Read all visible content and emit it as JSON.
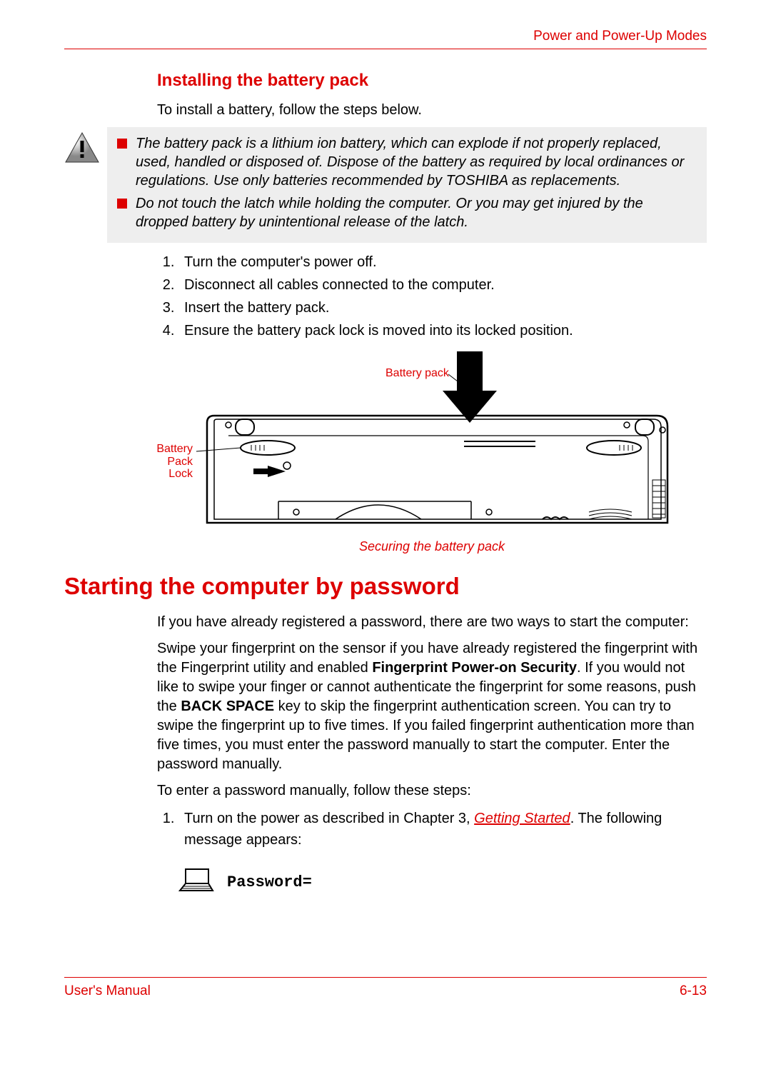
{
  "header": {
    "title": "Power and Power-Up Modes"
  },
  "section1": {
    "heading": "Installing the battery pack",
    "intro": "To install a battery, follow the steps below.",
    "cautions": [
      "The battery pack is a lithium ion battery, which can explode if not properly replaced, used, handled or disposed of. Dispose of the battery as required by local ordinances or regulations. Use only batteries recommended by TOSHIBA as replacements.",
      "Do not touch the latch while holding the computer. Or you may get injured by the dropped battery by unintentional release of the latch."
    ],
    "steps": [
      "Turn the computer's power off.",
      "Disconnect all cables connected to the computer.",
      "Insert the battery pack.",
      "Ensure the battery pack lock is moved into its locked position."
    ],
    "figure": {
      "label_battery_pack": "Battery pack",
      "label_battery_lock": "Battery Pack Lock",
      "caption": "Securing the battery pack"
    }
  },
  "section2": {
    "heading": "Starting the computer by password",
    "p1": "If you have already registered a password, there are two ways to start the computer:",
    "p2_pre": "Swipe your fingerprint on the sensor if you have already registered the fingerprint with the Fingerprint utility and enabled ",
    "p2_b1": "Fingerprint Power-on Security",
    "p2_mid": ". If you would not like to swipe your finger or cannot authenticate the fingerprint for some reasons, push the ",
    "p2_b2": "BACK SPACE",
    "p2_post": " key to skip the fingerprint authentication screen. You can try to swipe the fingerprint up to five times. If you failed fingerprint authentication more than five times, you must enter the password manually to start the computer. Enter the password manually.",
    "p3": "To enter a password manually, follow these steps:",
    "step1_pre": "Turn on the power as described in Chapter 3, ",
    "step1_link": "Getting Started",
    "step1_post": ". The following message appears:",
    "prompt": "Password="
  },
  "footer": {
    "left": "User's Manual",
    "right": "6-13"
  }
}
